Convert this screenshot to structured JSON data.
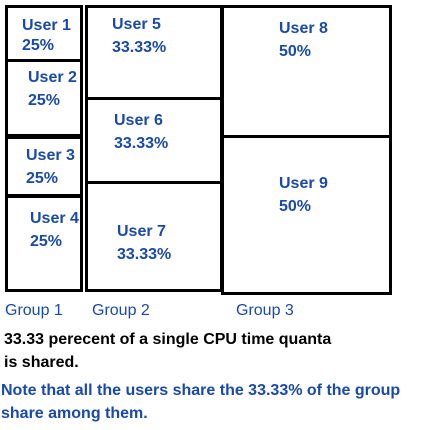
{
  "colors": {
    "user_text": "#1a4aa8",
    "group_text": "#1a4aa8",
    "note_black": "#000000",
    "note_blue": "#1a4aa8",
    "border": "#000000"
  },
  "users": [
    {
      "name": "User 1",
      "share": "25%"
    },
    {
      "name": "User 2",
      "share": "25%"
    },
    {
      "name": "User 3",
      "share": "25%"
    },
    {
      "name": "User 4",
      "share": "25%"
    },
    {
      "name": "User 5",
      "share": "33.33%"
    },
    {
      "name": "User 6",
      "share": "33.33%"
    },
    {
      "name": "User 7",
      "share": "33.33%"
    },
    {
      "name": "User 8",
      "share": "50%"
    },
    {
      "name": "User 9",
      "share": "50%"
    }
  ],
  "groups": [
    "Group 1",
    "Group 2",
    "Group 3"
  ],
  "notes": {
    "quanta_line1": "33.33 perecent of a single CPU time quanta",
    "quanta_line2": "is shared.",
    "share_line1": "Note that all the users share the 33.33% of the group",
    "share_line2": "share among them."
  }
}
